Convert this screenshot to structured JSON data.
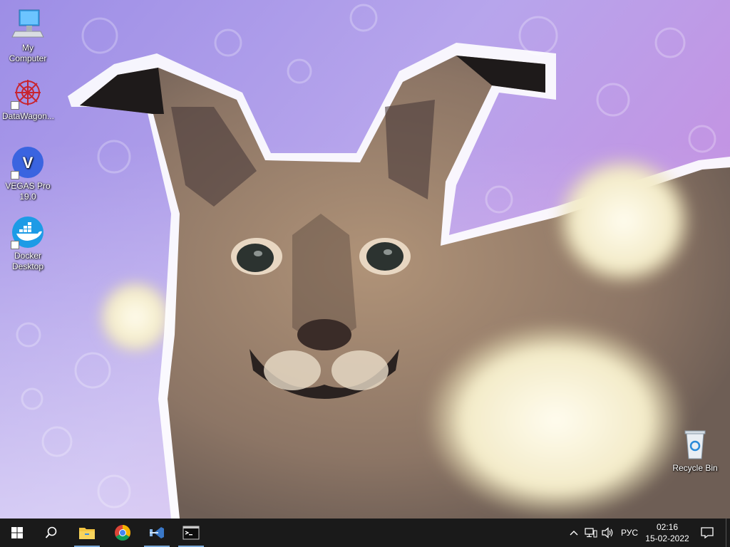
{
  "desktop": {
    "icons": [
      {
        "label": "My Computer",
        "icon": "computer-icon",
        "shortcut": false
      },
      {
        "label": "DataWagon...",
        "icon": "datawagon-icon",
        "shortcut": true
      },
      {
        "label": "VEGAS Pro 19.0",
        "icon": "vegas-pro-icon",
        "icon_text": "V",
        "shortcut": true
      },
      {
        "label": "Docker Desktop",
        "icon": "docker-icon",
        "shortcut": true
      },
      {
        "label": "Recycle Bin",
        "icon": "recycle-bin-icon",
        "shortcut": false
      }
    ],
    "wallpaper": {
      "subject": "caracal-cat",
      "colors": {
        "bg_top": "#9d8ee6",
        "bg_mid": "#c7b6ef",
        "bg_right": "#c78ee0"
      }
    }
  },
  "taskbar": {
    "start_icon": "windows-start-icon",
    "search_icon": "search-icon",
    "apps": [
      {
        "name": "File Explorer",
        "icon": "file-explorer-icon",
        "active": true
      },
      {
        "name": "Google Chrome",
        "icon": "chrome-icon",
        "active": false
      },
      {
        "name": "Visual Studio",
        "icon": "visual-studio-icon",
        "active": true
      },
      {
        "name": "Command Prompt",
        "icon": "terminal-icon",
        "active": true
      }
    ],
    "tray": {
      "language": "РУС",
      "time": "02:16",
      "date": "15-02-2022"
    },
    "colors": {
      "background": "#1a1a1a",
      "accent": "#7aa8d8"
    }
  }
}
